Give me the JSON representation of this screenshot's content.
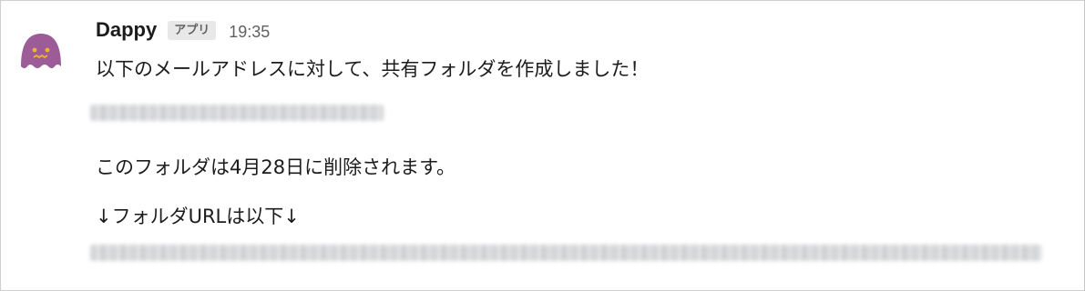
{
  "message": {
    "sender": "Dappy",
    "app_badge": "アプリ",
    "timestamp": "19:35",
    "lines": [
      "以下のメールアドレスに対して、共有フォルダを作成しました！",
      "このフォルダは4月28日に削除されます。",
      "↓フォルダURLは以下↓"
    ],
    "avatar_icon": "purple-ghost-bot-icon"
  },
  "colors": {
    "avatar": "#9b5c97",
    "avatar_face": "#f2b035",
    "text": "#1d1c1d",
    "muted": "#616061"
  }
}
